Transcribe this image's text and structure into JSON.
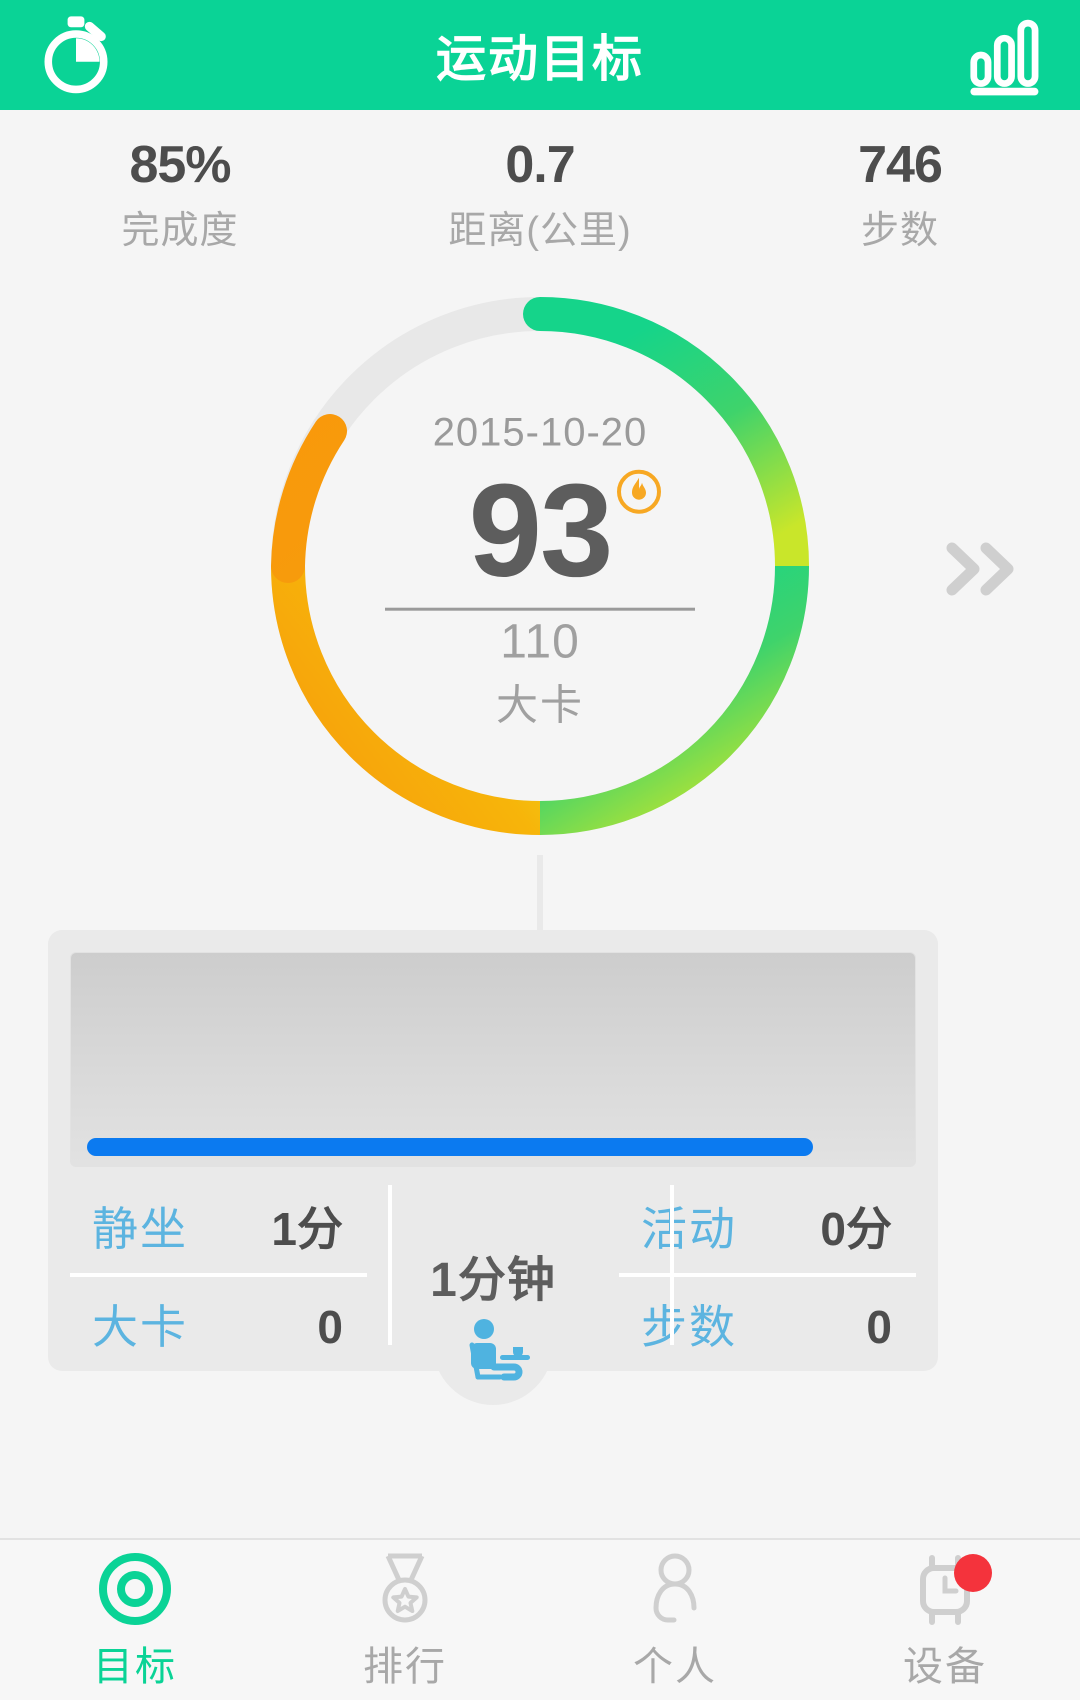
{
  "header": {
    "title": "运动目标",
    "left_icon": "stopwatch-icon",
    "right_icon": "bar-chart-icon",
    "background_color": "#0ad396"
  },
  "top_stats": [
    {
      "value": "85%",
      "label": "完成度"
    },
    {
      "value": "0.7",
      "label": "距离(公里)"
    },
    {
      "value": "746",
      "label": "步数"
    }
  ],
  "ring": {
    "date": "2015-10-20",
    "value": "93",
    "goal": "110",
    "unit": "大卡",
    "badge_icon": "flame-icon",
    "percent": 85,
    "track_color": "#e8e8e8",
    "gradient_start": "#15d48a",
    "gradient_mid": "#d8e830",
    "gradient_end": "#f79b0c",
    "next_icon": "double-chevron-right-icon"
  },
  "card": {
    "chart": {
      "bar_color": "#0b7af0",
      "bar_fill_percent": 86
    },
    "center_total": "1分钟",
    "rows": [
      {
        "label": "静坐",
        "value": "1分"
      },
      {
        "label": "活动",
        "value": "0分"
      },
      {
        "label": "大卡",
        "value": "0"
      },
      {
        "label": "步数",
        "value": "0"
      }
    ],
    "label_color": "#5cb4e0",
    "notch_icon": "sitting-person-desk-icon"
  },
  "bottom_nav": {
    "active_color": "#0ad396",
    "items": [
      {
        "label": "目标",
        "icon": "target-ring-icon",
        "active": true,
        "badge": false
      },
      {
        "label": "排行",
        "icon": "medal-icon",
        "active": false,
        "badge": false
      },
      {
        "label": "个人",
        "icon": "person-icon",
        "active": false,
        "badge": false
      },
      {
        "label": "设备",
        "icon": "watch-icon",
        "active": false,
        "badge": true
      }
    ]
  }
}
